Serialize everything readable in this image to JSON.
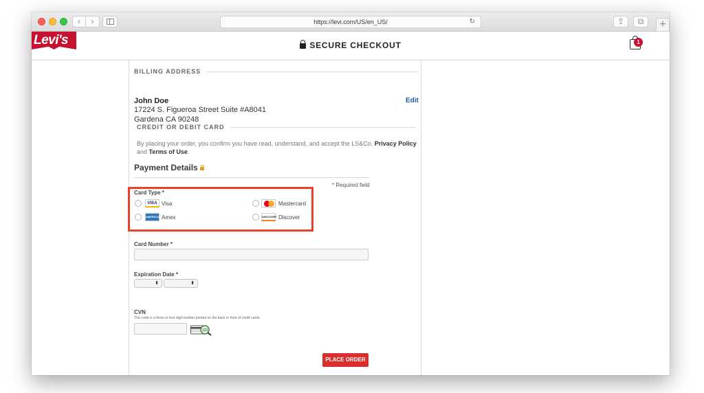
{
  "browser": {
    "url": "https://levi.com/US/en_US/",
    "back_glyph": "‹",
    "forward_glyph": "›",
    "new_tab_glyph": "+",
    "reload_glyph": "↻",
    "share_glyph": "⇪",
    "tabs_glyph": "⧉"
  },
  "header": {
    "logo_text": "Levi's",
    "logo_registered": "®",
    "secure_label": "SECURE CHECKOUT",
    "cart_count": "1",
    "brand_color": "#c41230"
  },
  "billing": {
    "section_title": "BILLING ADDRESS",
    "name": "John Doe",
    "line1": "17224 S. Figueroa Street Suite #A8041",
    "line2": "Gardena CA 90248",
    "edit_label": "Edit"
  },
  "card": {
    "section_title": "CREDIT OR DEBIT CARD",
    "legal_prefix": "By placing your order, you confirm you have read, understand, and accept the LS&Co.",
    "privacy_link": "Privacy Policy",
    "legal_and": "and",
    "terms_link": "Terms of Use",
    "legal_suffix": "."
  },
  "payment": {
    "title": "Payment Details",
    "required_note": "* Required field",
    "card_type_label": "Card Type *",
    "card_types": [
      {
        "name": "Visa",
        "logo_text": "VISA",
        "selected": false
      },
      {
        "name": "Mastercard",
        "logo_text": "",
        "selected": false
      },
      {
        "name": "Amex",
        "logo_text": "AMERICAN EXPRESS",
        "selected": false
      },
      {
        "name": "Discover",
        "logo_text": "DISCOVER",
        "selected": false
      }
    ],
    "card_number_label": "Card Number *",
    "card_number_value": "",
    "expiration_label": "Expiration Date *",
    "month_value": "",
    "year_value": "",
    "select_arrow": "⬍",
    "cvn_label": "CVN",
    "cvn_help": "This code is a three or four digit number printed on the back or front of credit cards.",
    "cvn_icon_text": "123",
    "place_order_label": "PLACE ORDER",
    "button_color": "#d72e2e",
    "highlight_color": "#e8402a"
  }
}
